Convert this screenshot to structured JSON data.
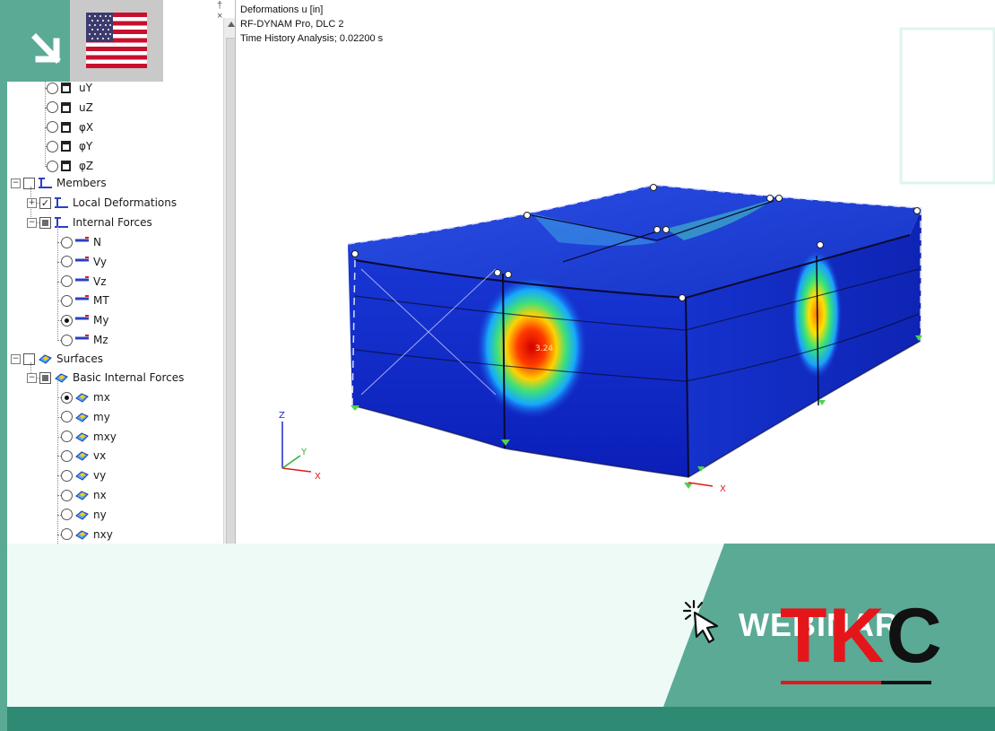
{
  "viewport": {
    "header_lines": [
      "Deformations u [in]",
      "RF-DYNAM Pro, DLC 2",
      "Time History Analysis; 0.02200 s"
    ],
    "value_label": "3.24",
    "axes": {
      "z": "Z",
      "y": "Y",
      "x": "X"
    },
    "support_axis_label": "X"
  },
  "tree": {
    "controls": {
      "pin": "†",
      "close": "×"
    },
    "nodes_items": [
      {
        "label": "uY",
        "selected": false
      },
      {
        "label": "uZ",
        "selected": false
      },
      {
        "label": "φX",
        "selected": false
      },
      {
        "label": "φY",
        "selected": false
      },
      {
        "label": "φZ",
        "selected": false
      }
    ],
    "members": {
      "label": "Members",
      "local_deformations": "Local Deformations",
      "internal_forces": "Internal Forces",
      "items": [
        {
          "label": "N",
          "selected": false
        },
        {
          "label": "Vy",
          "selected": false
        },
        {
          "label": "Vz",
          "selected": false
        },
        {
          "label": "MT",
          "selected": false
        },
        {
          "label": "My",
          "selected": true
        },
        {
          "label": "Mz",
          "selected": false
        }
      ]
    },
    "surfaces": {
      "label": "Surfaces",
      "basic_internal_forces": "Basic Internal Forces",
      "items": [
        {
          "label": "mx",
          "selected": true
        },
        {
          "label": "my",
          "selected": false
        },
        {
          "label": "mxy",
          "selected": false
        },
        {
          "label": "vx",
          "selected": false
        },
        {
          "label": "vy",
          "selected": false
        },
        {
          "label": "nx",
          "selected": false
        },
        {
          "label": "ny",
          "selected": false
        },
        {
          "label": "nxy",
          "selected": false
        }
      ]
    }
  },
  "banner": {
    "webinar_text": "WEBINAR",
    "logo_red": "TK",
    "logo_black": "C"
  },
  "colors": {
    "accent_green": "#5aaa96",
    "dark_green": "#2f8a73",
    "banner_bg": "#eefaf6",
    "logo_red": "#e5161a",
    "logo_black": "#111111"
  }
}
